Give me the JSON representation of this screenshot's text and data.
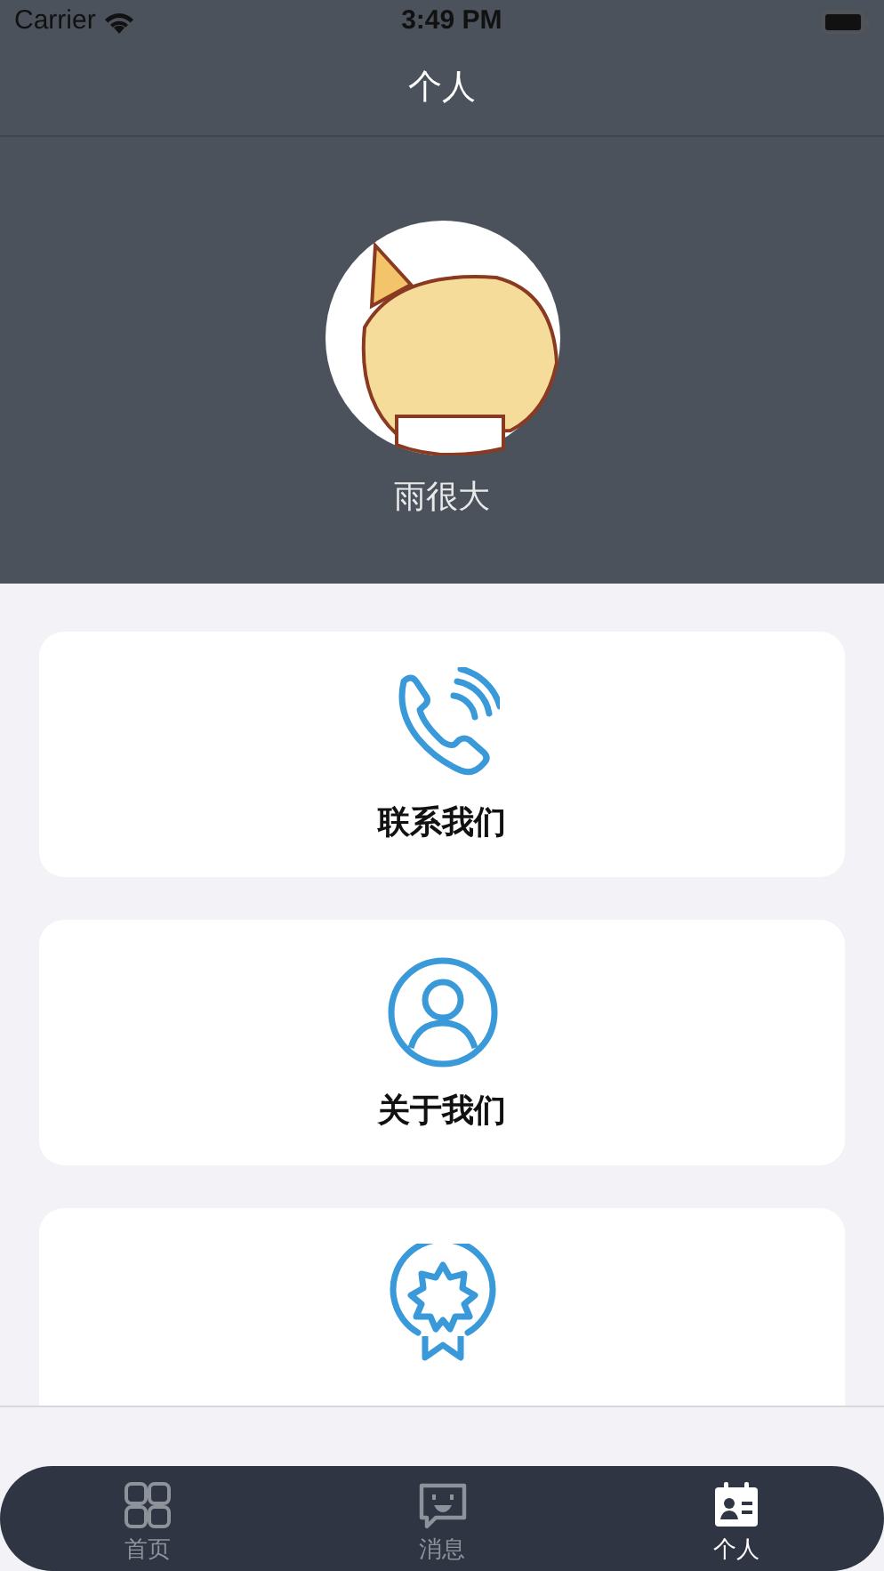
{
  "status_bar": {
    "carrier": "Carrier",
    "time": "3:49 PM"
  },
  "nav": {
    "title": "个人"
  },
  "profile": {
    "name": "雨很大"
  },
  "cards": [
    {
      "kind": "phone",
      "label": "联系我们"
    },
    {
      "kind": "person",
      "label": "关于我们"
    },
    {
      "kind": "badge"
    }
  ],
  "tabs": [
    {
      "kind": "grid",
      "label": "首页",
      "selected": false
    },
    {
      "kind": "chat",
      "label": "消息",
      "selected": false
    },
    {
      "kind": "idcard",
      "label": "个人",
      "selected": true
    }
  ]
}
